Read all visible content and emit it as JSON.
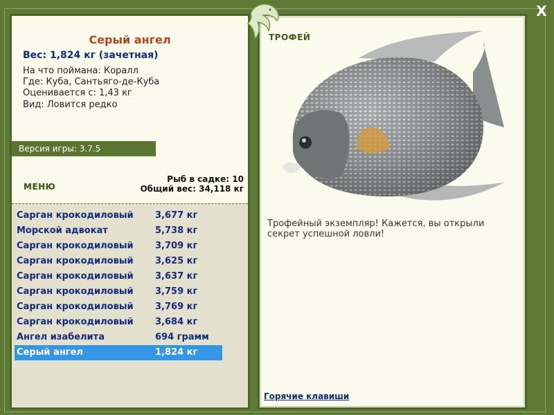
{
  "close_label": "X",
  "fish": {
    "title": "Серый ангел",
    "weight": "Вес: 1,824 кг (зачетная)",
    "caught_on": "На что поймана: Коралл",
    "where": "Где: Куба, Сантьяго-де-Куба",
    "valued": "Оценивается с: 1,43 кг",
    "species": "Вид: Ловится редко"
  },
  "version": "Версия игры: 3.7.5",
  "menu_label": "МЕНЮ",
  "cage": {
    "count": "Рыб в садке: 10",
    "total": "Общий вес: 34,118 кг"
  },
  "catch_list": [
    {
      "name": "Сарган крокодиловый",
      "weight": "3,677 кг"
    },
    {
      "name": "Морской адвокат",
      "weight": "5,738 кг"
    },
    {
      "name": "Сарган крокодиловый",
      "weight": "3,709 кг"
    },
    {
      "name": "Сарган крокодиловый",
      "weight": "3,625 кг"
    },
    {
      "name": "Сарган крокодиловый",
      "weight": "3,637 кг"
    },
    {
      "name": "Сарган крокодиловый",
      "weight": "3,759 кг"
    },
    {
      "name": "Сарган крокодиловый",
      "weight": "3,769 кг"
    },
    {
      "name": "Сарган крокодиловый",
      "weight": "3,684 кг"
    },
    {
      "name": "Ангел изабелита",
      "weight": "694 грамм"
    },
    {
      "name": "Серый ангел",
      "weight": "1,824 кг",
      "selected": true
    }
  ],
  "trophy_label": "ТРОФЕЙ",
  "trophy_text": "Трофейный экземпляр! Кажется, вы открыли секрет успешной ловли!",
  "hotkeys_label": "Горячие клавиши",
  "colors": {
    "frame": "#5f7a36",
    "panel": "#fafbed",
    "selection": "#3596e6",
    "list_text": "#142a7a",
    "title": "#b3471d"
  }
}
